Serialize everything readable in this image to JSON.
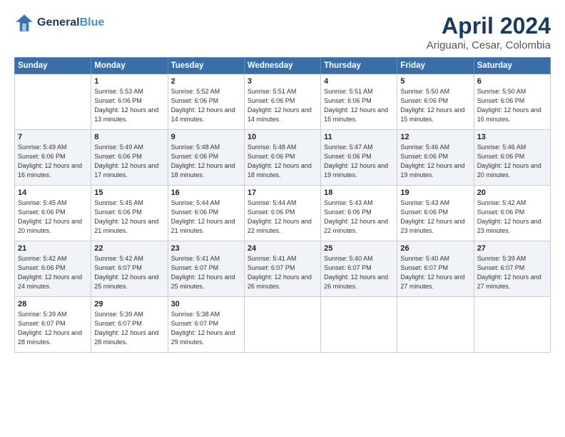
{
  "header": {
    "logo_line1": "General",
    "logo_line2": "Blue",
    "title": "April 2024",
    "subtitle": "Ariguani, Cesar, Colombia"
  },
  "days_of_week": [
    "Sunday",
    "Monday",
    "Tuesday",
    "Wednesday",
    "Thursday",
    "Friday",
    "Saturday"
  ],
  "weeks": [
    [
      {
        "day": "",
        "info": ""
      },
      {
        "day": "1",
        "info": "Sunrise: 5:53 AM\nSunset: 6:06 PM\nDaylight: 12 hours\nand 13 minutes."
      },
      {
        "day": "2",
        "info": "Sunrise: 5:52 AM\nSunset: 6:06 PM\nDaylight: 12 hours\nand 14 minutes."
      },
      {
        "day": "3",
        "info": "Sunrise: 5:51 AM\nSunset: 6:06 PM\nDaylight: 12 hours\nand 14 minutes."
      },
      {
        "day": "4",
        "info": "Sunrise: 5:51 AM\nSunset: 6:06 PM\nDaylight: 12 hours\nand 15 minutes."
      },
      {
        "day": "5",
        "info": "Sunrise: 5:50 AM\nSunset: 6:06 PM\nDaylight: 12 hours\nand 15 minutes."
      },
      {
        "day": "6",
        "info": "Sunrise: 5:50 AM\nSunset: 6:06 PM\nDaylight: 12 hours\nand 16 minutes."
      }
    ],
    [
      {
        "day": "7",
        "info": "Sunrise: 5:49 AM\nSunset: 6:06 PM\nDaylight: 12 hours\nand 16 minutes."
      },
      {
        "day": "8",
        "info": "Sunrise: 5:49 AM\nSunset: 6:06 PM\nDaylight: 12 hours\nand 17 minutes."
      },
      {
        "day": "9",
        "info": "Sunrise: 5:48 AM\nSunset: 6:06 PM\nDaylight: 12 hours\nand 18 minutes."
      },
      {
        "day": "10",
        "info": "Sunrise: 5:48 AM\nSunset: 6:06 PM\nDaylight: 12 hours\nand 18 minutes."
      },
      {
        "day": "11",
        "info": "Sunrise: 5:47 AM\nSunset: 6:06 PM\nDaylight: 12 hours\nand 19 minutes."
      },
      {
        "day": "12",
        "info": "Sunrise: 5:46 AM\nSunset: 6:06 PM\nDaylight: 12 hours\nand 19 minutes."
      },
      {
        "day": "13",
        "info": "Sunrise: 5:46 AM\nSunset: 6:06 PM\nDaylight: 12 hours\nand 20 minutes."
      }
    ],
    [
      {
        "day": "14",
        "info": "Sunrise: 5:45 AM\nSunset: 6:06 PM\nDaylight: 12 hours\nand 20 minutes."
      },
      {
        "day": "15",
        "info": "Sunrise: 5:45 AM\nSunset: 6:06 PM\nDaylight: 12 hours\nand 21 minutes."
      },
      {
        "day": "16",
        "info": "Sunrise: 5:44 AM\nSunset: 6:06 PM\nDaylight: 12 hours\nand 21 minutes."
      },
      {
        "day": "17",
        "info": "Sunrise: 5:44 AM\nSunset: 6:06 PM\nDaylight: 12 hours\nand 22 minutes."
      },
      {
        "day": "18",
        "info": "Sunrise: 5:43 AM\nSunset: 6:06 PM\nDaylight: 12 hours\nand 22 minutes."
      },
      {
        "day": "19",
        "info": "Sunrise: 5:43 AM\nSunset: 6:06 PM\nDaylight: 12 hours\nand 23 minutes."
      },
      {
        "day": "20",
        "info": "Sunrise: 5:42 AM\nSunset: 6:06 PM\nDaylight: 12 hours\nand 23 minutes."
      }
    ],
    [
      {
        "day": "21",
        "info": "Sunrise: 5:42 AM\nSunset: 6:06 PM\nDaylight: 12 hours\nand 24 minutes."
      },
      {
        "day": "22",
        "info": "Sunrise: 5:42 AM\nSunset: 6:07 PM\nDaylight: 12 hours\nand 25 minutes."
      },
      {
        "day": "23",
        "info": "Sunrise: 5:41 AM\nSunset: 6:07 PM\nDaylight: 12 hours\nand 25 minutes."
      },
      {
        "day": "24",
        "info": "Sunrise: 5:41 AM\nSunset: 6:07 PM\nDaylight: 12 hours\nand 26 minutes."
      },
      {
        "day": "25",
        "info": "Sunrise: 5:40 AM\nSunset: 6:07 PM\nDaylight: 12 hours\nand 26 minutes."
      },
      {
        "day": "26",
        "info": "Sunrise: 5:40 AM\nSunset: 6:07 PM\nDaylight: 12 hours\nand 27 minutes."
      },
      {
        "day": "27",
        "info": "Sunrise: 5:39 AM\nSunset: 6:07 PM\nDaylight: 12 hours\nand 27 minutes."
      }
    ],
    [
      {
        "day": "28",
        "info": "Sunrise: 5:39 AM\nSunset: 6:07 PM\nDaylight: 12 hours\nand 28 minutes."
      },
      {
        "day": "29",
        "info": "Sunrise: 5:39 AM\nSunset: 6:07 PM\nDaylight: 12 hours\nand 28 minutes."
      },
      {
        "day": "30",
        "info": "Sunrise: 5:38 AM\nSunset: 6:07 PM\nDaylight: 12 hours\nand 29 minutes."
      },
      {
        "day": "",
        "info": ""
      },
      {
        "day": "",
        "info": ""
      },
      {
        "day": "",
        "info": ""
      },
      {
        "day": "",
        "info": ""
      }
    ]
  ]
}
